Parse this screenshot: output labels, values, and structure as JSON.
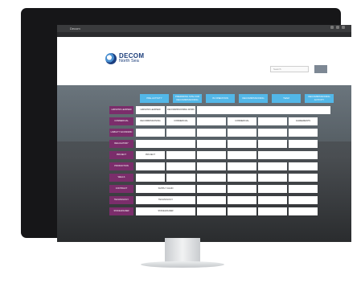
{
  "window": {
    "title": "Decom"
  },
  "site": {
    "brand_line1": "DECOM",
    "brand_line2": "North Sea"
  },
  "search": {
    "placeholder": "Search"
  },
  "nav": [
    "HOME",
    "TOOLS",
    "LESSONS",
    "FEEDBACK",
    "INDUSTRY INFORMATION",
    "HELP",
    "SEARCH"
  ],
  "top_buttons": [
    "PRE-ACTIVITY",
    "PREPARING SITE FOR DECOMMISSIONING",
    "IN OPERATION",
    "DECOMMISSIONING",
    "TEAM",
    "DECOMMISSIONING ACTIVITY"
  ],
  "rows": [
    {
      "label": "LESSONS LEARNED",
      "cells": [
        "LESSONS LEARNED",
        "DECOMMISSIONING WORK",
        "",
        "",
        "",
        ""
      ]
    },
    {
      "label": "COMMERCIAL",
      "cells": [
        "DECOMMISSIONING",
        "COMMERCIAL",
        "",
        "COMMERCIAL",
        "",
        "AGREEMENTS"
      ]
    },
    {
      "label": "LIABILITY ECONOMIC",
      "cells": [
        "",
        "",
        "",
        "",
        "",
        ""
      ]
    },
    {
      "label": "REGULATORY",
      "cells": [
        "",
        "",
        "",
        "",
        "",
        ""
      ]
    },
    {
      "label": "PROJECT",
      "cells": [
        "PROJECT",
        "",
        "",
        "",
        "",
        ""
      ]
    },
    {
      "label": "PRODUCTION",
      "cells": [
        "",
        "",
        "",
        "",
        "",
        ""
      ]
    },
    {
      "label": "WELLS",
      "cells": [
        "",
        "",
        "",
        "",
        "",
        ""
      ]
    },
    {
      "label": "CONTRACT",
      "cells": [
        "SUPPLY CHAIN",
        "",
        "",
        "",
        "",
        ""
      ]
    },
    {
      "label": "TECHNOLOGY",
      "cells": [
        "TECHNOLOGY",
        "",
        "",
        "",
        "",
        ""
      ]
    },
    {
      "label": "STAKEHOLDER",
      "cells": [
        "STAKEHOLDER",
        "",
        "",
        "",
        "",
        ""
      ]
    }
  ]
}
